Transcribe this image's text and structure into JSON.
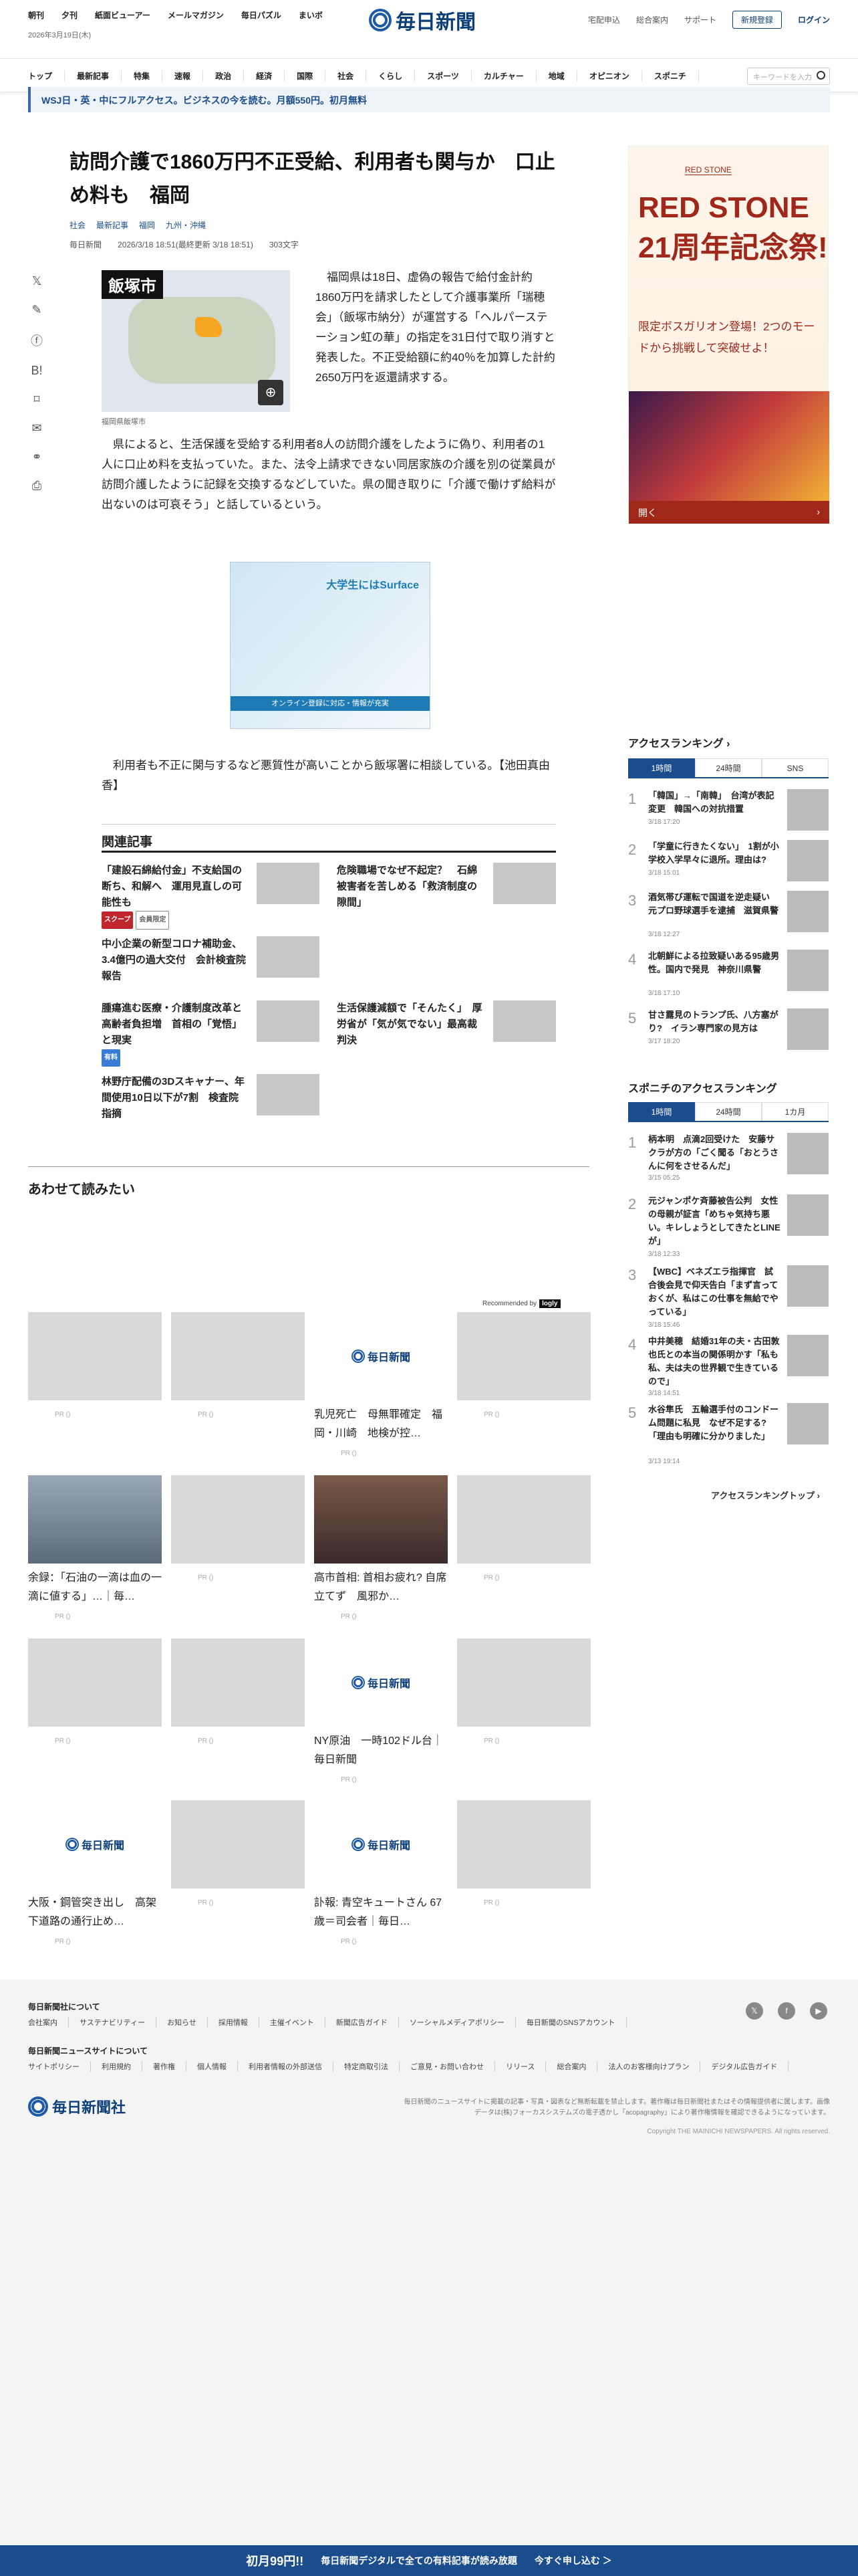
{
  "header": {
    "links": [
      "朝刊",
      "夕刊",
      "紙面ビューアー",
      "メールマガジン",
      "毎日パズル",
      "まいボ"
    ],
    "date": "2026年3月19日(木)",
    "logo": "毎日新聞",
    "right_links": [
      "宅配申込",
      "総合案内",
      "サポート"
    ],
    "register": "新規登録",
    "login": "ログイン"
  },
  "nav": {
    "items": [
      "トップ",
      "最新記事",
      "特集",
      "速報",
      "政治",
      "経済",
      "国際",
      "社会",
      "くらし",
      "スポーツ",
      "カルチャー",
      "地域",
      "オピニオン",
      "スポニチ"
    ],
    "search_placeholder": "キーワードを入力"
  },
  "promo": "WSJ日・英・中にフルアクセス。ビジネスの今を読む。月額550円。初月無料",
  "article": {
    "title": "訪問介護で1860万円不正受給、利用者も関与か　口止め料も　福岡",
    "tags": [
      "社会",
      "最新記事",
      "福岡",
      "九州・沖縄"
    ],
    "source": "毎日新聞",
    "timestamp": "2026/3/18 18:51(最終更新 3/18 18:51)",
    "chars": "303文字",
    "map_label": "飯塚市",
    "map_caption": "福岡県飯塚市",
    "para1": "福岡県は18日、虚偽の報告で給付金計約1860万円を請求したとして介護事業所「瑞穂会」（飯塚市納分）が運営する「ヘルパーステーション虹の華」の指定を31日付で取り消すと発表した。不正受給額に約40％を加算した計約2650万円を返還請求する。",
    "para2": "県によると、生活保護を受給する利用者8人の訪問介護をしたように偽り、利用者の1人に口止め料を支払っていた。また、法令上請求できない同居家族の介護を別の従業員が訪問介護したように記録を交換するなどしていた。県の聞き取りに「介護で働けず給料が出ないのは可哀そう」と話しているという。",
    "para3": "利用者も不正に関与するなど悪質性が高いことから飯塚署に相談している。【池田真由香】",
    "ad_text": "大学生にはSurface",
    "ad_bar": "オンライン登録に対応・情報が充実"
  },
  "related": {
    "heading": "関連記事",
    "items": [
      {
        "title": "「建設石綿給付金」不支給国の断ち、和解へ　運用見直しの可能性も",
        "badges": [
          "スクープ",
          "会員限定"
        ]
      },
      {
        "title": "危険職場でなぜ不起定？　石綿被害者を苦しめる「救済制度の隙間」"
      },
      {
        "title": "中小企業の新型コロナ補助金、3.4億円の過大交付　会計検査院報告"
      },
      {
        "title": "生活保護減額で「そんたく」　厚労省が「気が気でない」最高裁判決"
      },
      {
        "title": "腫瘍進む医療・介護制度改革と高齢者負担増　首相の「覚悟」と現実",
        "badges": [
          "有料"
        ]
      },
      {
        "title": "林野庁配備の3Dスキャナー、年間使用10日以下が7割　検査院指摘"
      }
    ]
  },
  "sidebar": {
    "ad": {
      "label": "RED STONE",
      "headline": "RED STONE 21周年記念祭!",
      "sub": "限定ボスガリオン登場！2つのモードから挑戦して突破せよ！",
      "open": "開く"
    },
    "ranking": {
      "heading": "アクセスランキング",
      "tabs": [
        "1時間",
        "24時間",
        "SNS"
      ],
      "items": [
        {
          "n": "1",
          "title": "「韓国」→「南韓」　台湾が表記変更　韓国への対抗措置",
          "date": "3/18 17:20"
        },
        {
          "n": "2",
          "title": "「学童に行きたくない」　1割が小学校入学早々に退所。理由は?",
          "date": "3/18 15:01"
        },
        {
          "n": "3",
          "title": "酒気帯び運転で国道を逆走疑い　元プロ野球選手を逮捕　滋賀県警",
          "date": "3/18 12:27"
        },
        {
          "n": "4",
          "title": "北朝鮮による拉致疑いある95歳男性。国内で発見　神奈川県警",
          "date": "3/18 17:10"
        },
        {
          "n": "5",
          "title": "甘さ露見のトランプ氏、八方塞がり?　イラン専門家の見方は",
          "date": "3/17 18:20"
        }
      ]
    },
    "sponichi": {
      "heading": "スポニチのアクセスランキング",
      "tabs": [
        "1時間",
        "24時間",
        "1カ月"
      ],
      "items": [
        {
          "n": "1",
          "title": "柄本明　点滴2回受けた　安藤サクラが方の「ごく聞る「おとうさんに何をさせるんだ」",
          "date": "3/15 05:25"
        },
        {
          "n": "2",
          "title": "元ジャンポケ斉藤被告公判　女性の母親が証言「めちゃ気持ち悪い。キレしょうとしてきたとLINEが」",
          "date": "3/18 12:33"
        },
        {
          "n": "3",
          "title": "【WBC】ベネズエラ指揮官　試合後会見で仰天告白「まず言っておくが、私はこの仕事を無給でやっている」",
          "date": "3/18 15:46"
        },
        {
          "n": "4",
          "title": "中井美穂　結婚31年の夫・古田敦也氏との本当の関係明かす「私も私、夫は夫の世界観で生きているので」",
          "date": "3/18 14:51"
        },
        {
          "n": "5",
          "title": "水谷隼氏　五輪選手付のコンドーム問題に私見　なぜ不足する?「理由も明確に分かりました」",
          "date": "3/13 19:14"
        }
      ],
      "more": "アクセスランキングトップ"
    }
  },
  "readmore": {
    "heading": "あわせて読みたい",
    "recommended": "Recommended by",
    "recommended_brand": "logly",
    "pr": "PR ()",
    "cards": [
      {
        "title": "",
        "logo": false
      },
      {
        "title": "",
        "logo": false
      },
      {
        "title": "乳児死亡　母無罪確定　福岡・川崎　地検が控…",
        "logo": true
      },
      {
        "title": "",
        "logo": false
      },
      {
        "title": "余録：「石油の一滴は血の一滴に値する」…｜毎…",
        "logo": false
      },
      {
        "title": "",
        "logo": false
      },
      {
        "title": "高市首相: 首相お疲れ? 自席立てず　風邪か…",
        "logo": false
      },
      {
        "title": "",
        "logo": false
      },
      {
        "title": "",
        "logo": false
      },
      {
        "title": "",
        "logo": false
      },
      {
        "title": "NY原油　一時102ドル台｜毎日新聞",
        "logo": true
      },
      {
        "title": "",
        "logo": false
      },
      {
        "title": "大阪・鋼管突き出し　高架下道路の通行止め…",
        "logo": true
      },
      {
        "title": "",
        "logo": false
      },
      {
        "title": "訃報: 青空キュートさん 67歳＝司会者｜毎日…",
        "logo": true
      },
      {
        "title": "",
        "logo": false
      }
    ]
  },
  "footer": {
    "about": "毎日新聞社について",
    "about_links": [
      "会社案内",
      "サステナビリティー",
      "お知らせ",
      "採用情報",
      "主催イベント",
      "新聞広告ガイド",
      "ソーシャルメディアポリシー",
      "毎日新聞のSNSアカウント"
    ],
    "site": "毎日新聞ニュースサイトについて",
    "site_links": [
      "サイトポリシー",
      "利用規約",
      "著作権",
      "個人情報",
      "利用者情報の外部送信",
      "特定商取引法",
      "ご意見・お問い合わせ",
      "リリース",
      "総合案内",
      "法人のお客様向けプラン",
      "デジタル広告ガイド"
    ],
    "logo": "毎日新聞社",
    "note": "毎日新聞のニュースサイトに掲載の記事・写真・図表など無断転載を禁止します。著作権は毎日新聞社またはその情報提供者に属します。画像データは(株)フォーカスシステムズの電子透かし「acopagraphy」により著作権情報を確認できるようになっています。",
    "copyright": "Copyright THE MAINICHI NEWSPAPERS. All rights reserved."
  },
  "bottom_banner": {
    "price": "初月99円!!",
    "text": "毎日新聞デジタルで全ての有料記事が読み放題",
    "cta": "今すぐ申し込む ＞"
  }
}
